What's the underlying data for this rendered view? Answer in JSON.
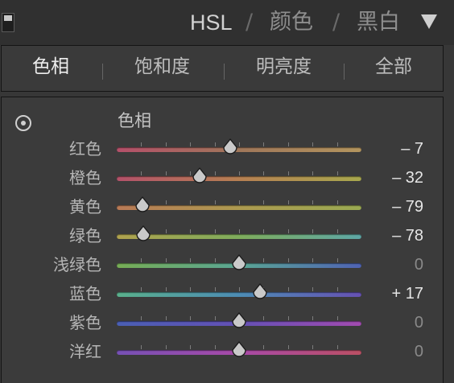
{
  "header": {
    "collapse_icon": "panel-collapse-icon",
    "hsl": "HSL",
    "separator": "/",
    "color": "颜色",
    "bw": "黑白",
    "menu_icon": "triangle-down-icon"
  },
  "tabs": [
    {
      "label": "色相",
      "active": true
    },
    {
      "label": "饱和度",
      "active": false
    },
    {
      "label": "明亮度",
      "active": false
    },
    {
      "label": "全部",
      "active": false
    }
  ],
  "section": {
    "target_icon": "target-adjustment-icon",
    "title": "色相"
  },
  "sliders": [
    {
      "label": "红色",
      "value": "– 7",
      "numeric": -7,
      "gradient": [
        "#b5506a",
        "#a0775a",
        "#b3955e"
      ]
    },
    {
      "label": "橙色",
      "value": "– 32",
      "numeric": -32,
      "gradient": [
        "#b4526a",
        "#b78052",
        "#a8a84e"
      ]
    },
    {
      "label": "黄色",
      "value": "– 79",
      "numeric": -79,
      "gradient": [
        "#b97a56",
        "#ad9a50",
        "#9aaa52"
      ]
    },
    {
      "label": "绿色",
      "value": "– 78",
      "numeric": -78,
      "gradient": [
        "#b0a24e",
        "#7fad5c",
        "#5ea7a6"
      ]
    },
    {
      "label": "浅绿色",
      "value": "0",
      "numeric": 0,
      "gradient": [
        "#77ad55",
        "#5aa694",
        "#4f63b4"
      ]
    },
    {
      "label": "蓝色",
      "value": "+ 17",
      "numeric": 17,
      "gradient": [
        "#5ab08c",
        "#4d8cb4",
        "#6651b3"
      ]
    },
    {
      "label": "紫色",
      "value": "0",
      "numeric": 0,
      "gradient": [
        "#4a5fb4",
        "#6451b5",
        "#a24bb0"
      ]
    },
    {
      "label": "洋红",
      "value": "0",
      "numeric": 0,
      "gradient": [
        "#7651b5",
        "#a84aa8",
        "#bb5064"
      ]
    }
  ],
  "colors": {
    "background": "#373737",
    "thumb": "#c9c9c9",
    "text": "#b5b5b5"
  }
}
